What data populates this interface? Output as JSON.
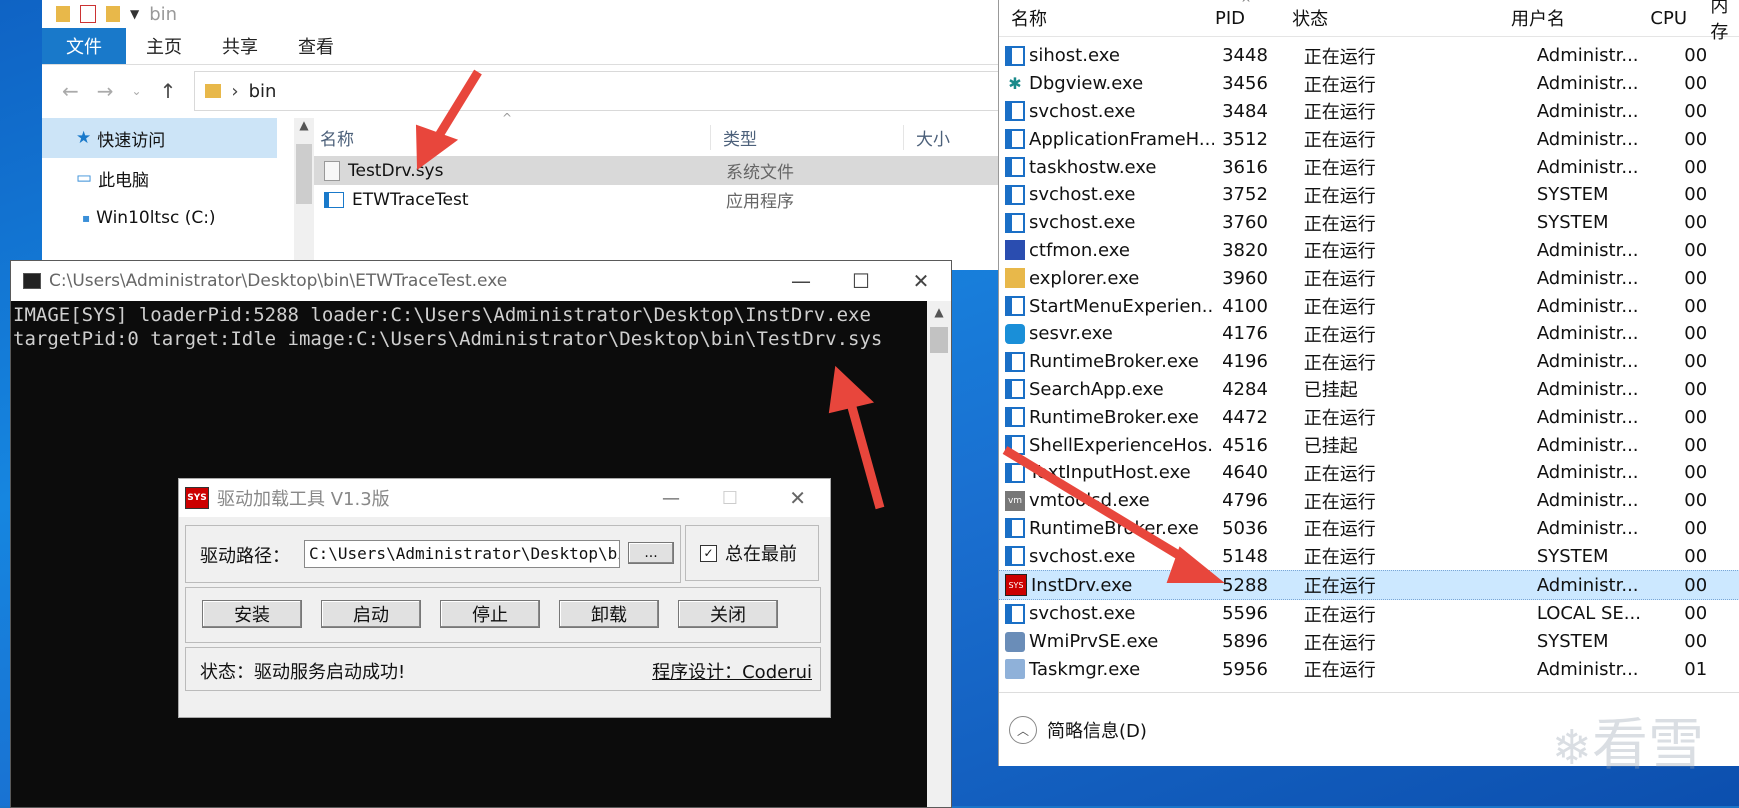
{
  "explorer": {
    "path_title": "bin",
    "ribbon_tabs": [
      "文件",
      "主页",
      "共享",
      "查看"
    ],
    "address_folder": "bin",
    "nav_items": [
      "快速访问",
      "此电脑",
      "Win10ltsc (C:)"
    ],
    "columns": {
      "name": "名称",
      "type": "类型",
      "size": "大小"
    },
    "files": [
      {
        "name": "TestDrv.sys",
        "type": "系统文件"
      },
      {
        "name": "ETWTraceTest",
        "type": "应用程序"
      }
    ]
  },
  "console": {
    "title": "C:\\Users\\Administrator\\Desktop\\bin\\ETWTraceTest.exe",
    "lines": [
      "IMAGE[SYS] loaderPid:5288 loader:C:\\Users\\Administrator\\Desktop\\InstDrv.exe",
      "targetPid:0 target:Idle image:C:\\Users\\Administrator\\Desktop\\bin\\TestDrv.sys"
    ]
  },
  "driver_tool": {
    "title": "驱动加载工具 V1.3版",
    "icon_label": "SYS",
    "path_label": "驱动路径：",
    "path_value": "C:\\Users\\Administrator\\Desktop\\bin",
    "browse_label": "...",
    "topmost_label": "总在最前",
    "buttons": [
      "安装",
      "启动",
      "停止",
      "卸载",
      "关闭"
    ],
    "status": "状态：驱动服务启动成功!",
    "author": "程序设计：Coderui"
  },
  "taskmgr": {
    "columns": [
      "名称",
      "PID",
      "状态",
      "用户名",
      "CPU",
      "内存"
    ],
    "processes": [
      {
        "name": "sihost.exe",
        "pid": "3448",
        "status": "正在运行",
        "user": "Administr...",
        "cpu": "00",
        "icon": "window-icon"
      },
      {
        "name": "Dbgview.exe",
        "pid": "3456",
        "status": "正在运行",
        "user": "Administr...",
        "cpu": "00",
        "icon": "bug-icon"
      },
      {
        "name": "svchost.exe",
        "pid": "3484",
        "status": "正在运行",
        "user": "Administr...",
        "cpu": "00",
        "icon": "window-icon"
      },
      {
        "name": "ApplicationFrameH...",
        "pid": "3512",
        "status": "正在运行",
        "user": "Administr...",
        "cpu": "00",
        "icon": "window-icon"
      },
      {
        "name": "taskhostw.exe",
        "pid": "3616",
        "status": "正在运行",
        "user": "Administr...",
        "cpu": "00",
        "icon": "window-icon"
      },
      {
        "name": "svchost.exe",
        "pid": "3752",
        "status": "正在运行",
        "user": "SYSTEM",
        "cpu": "00",
        "icon": "window-icon"
      },
      {
        "name": "svchost.exe",
        "pid": "3760",
        "status": "正在运行",
        "user": "SYSTEM",
        "cpu": "00",
        "icon": "window-icon"
      },
      {
        "name": "ctfmon.exe",
        "pid": "3820",
        "status": "正在运行",
        "user": "Administr...",
        "cpu": "00",
        "icon": "pen-icon"
      },
      {
        "name": "explorer.exe",
        "pid": "3960",
        "status": "正在运行",
        "user": "Administr...",
        "cpu": "00",
        "icon": "folder-icon"
      },
      {
        "name": "StartMenuExperien...",
        "pid": "4100",
        "status": "正在运行",
        "user": "Administr...",
        "cpu": "00",
        "icon": "window-icon"
      },
      {
        "name": "sesvr.exe",
        "pid": "4176",
        "status": "正在运行",
        "user": "Administr...",
        "cpu": "00",
        "icon": "globe-icon"
      },
      {
        "name": "RuntimeBroker.exe",
        "pid": "4196",
        "status": "正在运行",
        "user": "Administr...",
        "cpu": "00",
        "icon": "window-icon"
      },
      {
        "name": "SearchApp.exe",
        "pid": "4284",
        "status": "已挂起",
        "user": "Administr...",
        "cpu": "00",
        "icon": "window-icon"
      },
      {
        "name": "RuntimeBroker.exe",
        "pid": "4472",
        "status": "正在运行",
        "user": "Administr...",
        "cpu": "00",
        "icon": "window-icon"
      },
      {
        "name": "ShellExperienceHos...",
        "pid": "4516",
        "status": "已挂起",
        "user": "Administr...",
        "cpu": "00",
        "icon": "window-icon"
      },
      {
        "name": "TextInputHost.exe",
        "pid": "4640",
        "status": "正在运行",
        "user": "Administr...",
        "cpu": "00",
        "icon": "window-icon"
      },
      {
        "name": "vmtoolsd.exe",
        "pid": "4796",
        "status": "正在运行",
        "user": "Administr...",
        "cpu": "00",
        "icon": "vm-icon"
      },
      {
        "name": "RuntimeBroker.exe",
        "pid": "5036",
        "status": "正在运行",
        "user": "Administr...",
        "cpu": "00",
        "icon": "window-icon"
      },
      {
        "name": "svchost.exe",
        "pid": "5148",
        "status": "正在运行",
        "user": "SYSTEM",
        "cpu": "00",
        "icon": "window-icon"
      },
      {
        "name": "InstDrv.exe",
        "pid": "5288",
        "status": "正在运行",
        "user": "Administr...",
        "cpu": "00",
        "icon": "sys-icon",
        "selected": true
      },
      {
        "name": "svchost.exe",
        "pid": "5596",
        "status": "正在运行",
        "user": "LOCAL SE...",
        "cpu": "00",
        "icon": "window-icon"
      },
      {
        "name": "WmiPrvSE.exe",
        "pid": "5896",
        "status": "正在运行",
        "user": "SYSTEM",
        "cpu": "00",
        "icon": "gear-icon"
      },
      {
        "name": "Taskmgr.exe",
        "pid": "5956",
        "status": "正在运行",
        "user": "Administr...",
        "cpu": "01",
        "icon": "chart-icon"
      }
    ],
    "footer": "简略信息(D)"
  },
  "watermark": "看雪",
  "colors": {
    "accent": "#1979ca",
    "arrow": "#e8463c",
    "selection": "#cce8ff"
  }
}
